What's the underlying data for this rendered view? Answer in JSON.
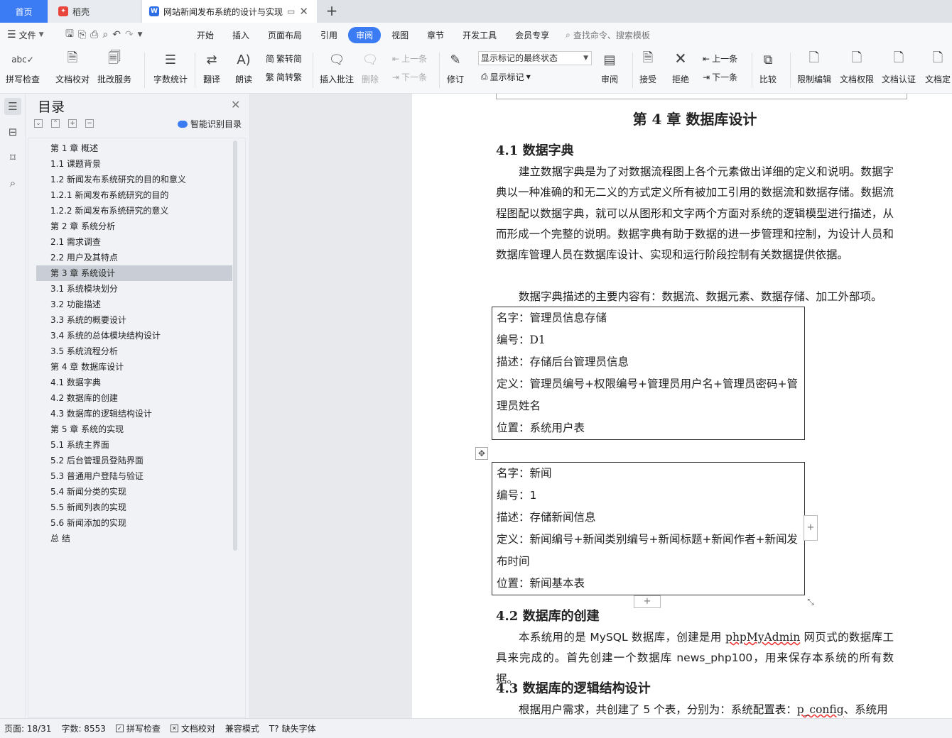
{
  "tabs": {
    "home": "首页",
    "daoke": "稻壳",
    "document": "网站新闻发布系统的设计与实现"
  },
  "menu": {
    "file": "文件",
    "items": [
      "开始",
      "插入",
      "页面布局",
      "引用",
      "审阅",
      "视图",
      "章节",
      "开发工具",
      "会员专享"
    ],
    "active_index": 4,
    "search_placeholder": "查找命令、搜索模板"
  },
  "ribbon": {
    "spellcheck": "拼写检查",
    "doc_proof": "文档校对",
    "batch_service": "批改服务",
    "word_count": "字数统计",
    "translate": "翻译",
    "read_aloud": "朗读",
    "to_traditional": "简转繁",
    "to_simplified": "繁转简",
    "insert_comment": "插入批注",
    "delete": "删除",
    "prev_comment": "上一条",
    "next_comment": "下一条",
    "revise": "修订",
    "markup_state": "显示标记的最终状态",
    "show_markup": "显示标记",
    "review": "审阅",
    "accept": "接受",
    "reject": "拒绝",
    "prev_change": "上一条",
    "next_change": "下一条",
    "compare": "比较",
    "restrict_edit": "限制编辑",
    "doc_permission": "文档权限",
    "doc_certify": "文档认证",
    "doc_final": "文档定"
  },
  "toc": {
    "title": "目录",
    "smart_label": "智能识别目录",
    "selected_index": 8,
    "items": [
      "第 1 章  概述",
      "1.1  课题背景",
      "1.2 新闻发布系统研究的目的和意义",
      "1.2.1 新闻发布系统研究的目的",
      "1.2.2 新闻发布系统研究的意义",
      "第 2 章  系统分析",
      "2.1  需求调查",
      "2.2 用户及其特点",
      "第 3 章  系统设计",
      "3.1  系统模块划分",
      "3.2  功能描述",
      "3.3 系统的概要设计",
      "3.4  系统的总体模块结构设计",
      "3.5 系统流程分析",
      "第 4 章  数据库设计",
      "4.1 数据字典",
      "4.2 数据库的创建",
      "4.3 数据库的逻辑结构设计",
      "第 5 章  系统的实现",
      "5.1   系统主界面",
      "5.2   后台管理员登陆界面",
      "5.3   普通用户登陆与验证",
      "5.4 新闻分类的实现",
      "5.5   新闻列表的实现",
      "5.6   新闻添加的实现",
      "总    结"
    ]
  },
  "document": {
    "chapter_title": "第 4 章  数据库设计",
    "sec41": "4.1 数据字典",
    "para1": "建立数据字典是为了对数据流程图上各个元素做出详细的定义和说明。数据字典以一种准确的和无二义的方式定义所有被加工引用的数据流和数据存储。数据流程图配以数据字典，就可以从图形和文字两个方面对系统的逻辑模型进行描述，从而形成一个完整的说明。数据字典有助于数据的进一步管理和控制，为设计人员和数据库管理人员在数据库设计、实现和运行阶段控制有关数据提供依据。",
    "para2": "数据字典描述的主要内容有：数据流、数据元素、数据存储、加工外部项。",
    "box1": {
      "name": "名字：管理员信息存储",
      "code": "编号：D1",
      "desc": "描述：存储后台管理员信息",
      "def": "定义：管理员编号+权限编号+管理员用户名+管理员密码+管理员姓名",
      "loc": "位置：系统用户表"
    },
    "box2": {
      "name": "名字：新闻",
      "code": "编号：1",
      "desc": "描述：存储新闻信息",
      "def": "定义：新闻编号+新闻类别编号+新闻标题+新闻作者+新闻发布时间",
      "loc": "位置：新闻基本表"
    },
    "sec42": "4.2 数据库的创建",
    "para3_a": "本系统用的是 MySQL 数据库，创建是用 ",
    "para3_b": "phpMyAdmin",
    "para3_c": " 网页式的数据库工具来完成的。首先创建一个数据库 news_php100，用来保存本系统的所有数据。",
    "sec43": "4.3 数据库的逻辑结构设计",
    "para4_a": "根据用户需求，共创建了 5 个表，分别为：系统配置表：",
    "para4_b": "p_config",
    "para4_c": "、系统用"
  },
  "status": {
    "page": "页面: 18/31",
    "words": "字数: 8553",
    "spellcheck": "拼写检查",
    "proofread": "文档校对",
    "compat": "兼容模式",
    "missing_font": "缺失字体"
  },
  "colors": {
    "accent": "#3b7cf4",
    "daoke_logo": "#e8453c",
    "wps_logo": "#2b6de5"
  }
}
